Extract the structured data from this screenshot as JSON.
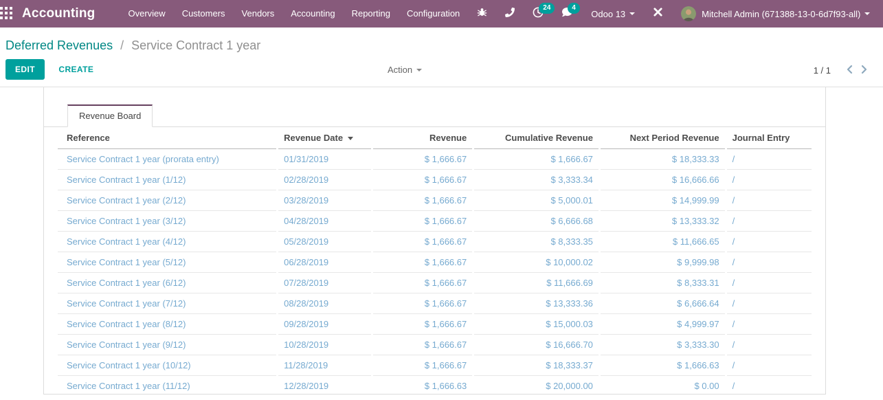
{
  "topbar": {
    "app_name": "Accounting",
    "menu": [
      "Overview",
      "Customers",
      "Vendors",
      "Accounting",
      "Reporting",
      "Configuration"
    ],
    "systray": {
      "activities_count": "24",
      "messages_count": "4",
      "version_label": "Odoo 13",
      "user_name": "Mitchell Admin (671388-13-0-6d7f93-all)"
    }
  },
  "breadcrumb": {
    "parent": "Deferred Revenues",
    "separator": "/",
    "current": "Service Contract 1 year"
  },
  "control_panel": {
    "edit_label": "EDIT",
    "create_label": "CREATE",
    "action_label": "Action",
    "pager_value": "1 / 1"
  },
  "sheet": {
    "tab_label": "Revenue Board",
    "table": {
      "columns": [
        "Reference",
        "Revenue Date",
        "Revenue",
        "Cumulative Revenue",
        "Next Period Revenue",
        "Journal Entry"
      ],
      "sorted_column": "Revenue Date",
      "sort_direction": "desc",
      "rows": [
        {
          "reference": "Service Contract 1 year (prorata entry)",
          "revenue_date": "01/31/2019",
          "revenue": "$ 1,666.67",
          "cumulative_revenue": "$ 1,666.67",
          "next_period_revenue": "$ 18,333.33",
          "journal_entry": "/"
        },
        {
          "reference": "Service Contract 1 year (1/12)",
          "revenue_date": "02/28/2019",
          "revenue": "$ 1,666.67",
          "cumulative_revenue": "$ 3,333.34",
          "next_period_revenue": "$ 16,666.66",
          "journal_entry": "/"
        },
        {
          "reference": "Service Contract 1 year (2/12)",
          "revenue_date": "03/28/2019",
          "revenue": "$ 1,666.67",
          "cumulative_revenue": "$ 5,000.01",
          "next_period_revenue": "$ 14,999.99",
          "journal_entry": "/"
        },
        {
          "reference": "Service Contract 1 year (3/12)",
          "revenue_date": "04/28/2019",
          "revenue": "$ 1,666.67",
          "cumulative_revenue": "$ 6,666.68",
          "next_period_revenue": "$ 13,333.32",
          "journal_entry": "/"
        },
        {
          "reference": "Service Contract 1 year (4/12)",
          "revenue_date": "05/28/2019",
          "revenue": "$ 1,666.67",
          "cumulative_revenue": "$ 8,333.35",
          "next_period_revenue": "$ 11,666.65",
          "journal_entry": "/"
        },
        {
          "reference": "Service Contract 1 year (5/12)",
          "revenue_date": "06/28/2019",
          "revenue": "$ 1,666.67",
          "cumulative_revenue": "$ 10,000.02",
          "next_period_revenue": "$ 9,999.98",
          "journal_entry": "/"
        },
        {
          "reference": "Service Contract 1 year (6/12)",
          "revenue_date": "07/28/2019",
          "revenue": "$ 1,666.67",
          "cumulative_revenue": "$ 11,666.69",
          "next_period_revenue": "$ 8,333.31",
          "journal_entry": "/"
        },
        {
          "reference": "Service Contract 1 year (7/12)",
          "revenue_date": "08/28/2019",
          "revenue": "$ 1,666.67",
          "cumulative_revenue": "$ 13,333.36",
          "next_period_revenue": "$ 6,666.64",
          "journal_entry": "/"
        },
        {
          "reference": "Service Contract 1 year (8/12)",
          "revenue_date": "09/28/2019",
          "revenue": "$ 1,666.67",
          "cumulative_revenue": "$ 15,000.03",
          "next_period_revenue": "$ 4,999.97",
          "journal_entry": "/"
        },
        {
          "reference": "Service Contract 1 year (9/12)",
          "revenue_date": "10/28/2019",
          "revenue": "$ 1,666.67",
          "cumulative_revenue": "$ 16,666.70",
          "next_period_revenue": "$ 3,333.30",
          "journal_entry": "/"
        },
        {
          "reference": "Service Contract 1 year (10/12)",
          "revenue_date": "11/28/2019",
          "revenue": "$ 1,666.67",
          "cumulative_revenue": "$ 18,333.37",
          "next_period_revenue": "$ 1,666.63",
          "journal_entry": "/"
        },
        {
          "reference": "Service Contract 1 year (11/12)",
          "revenue_date": "12/28/2019",
          "revenue": "$ 1,666.63",
          "cumulative_revenue": "$ 20,000.00",
          "next_period_revenue": "$ 0.00",
          "journal_entry": "/"
        }
      ]
    }
  },
  "colors": {
    "topbar_bg": "#875A7B",
    "accent_teal": "#00A09D",
    "breadcrumb_link": "#008784",
    "row_text": "#76AAD0",
    "header_text": "#4C4C4C",
    "muted_text": "#8F8F8F",
    "tab_top_border": "#66415F"
  }
}
